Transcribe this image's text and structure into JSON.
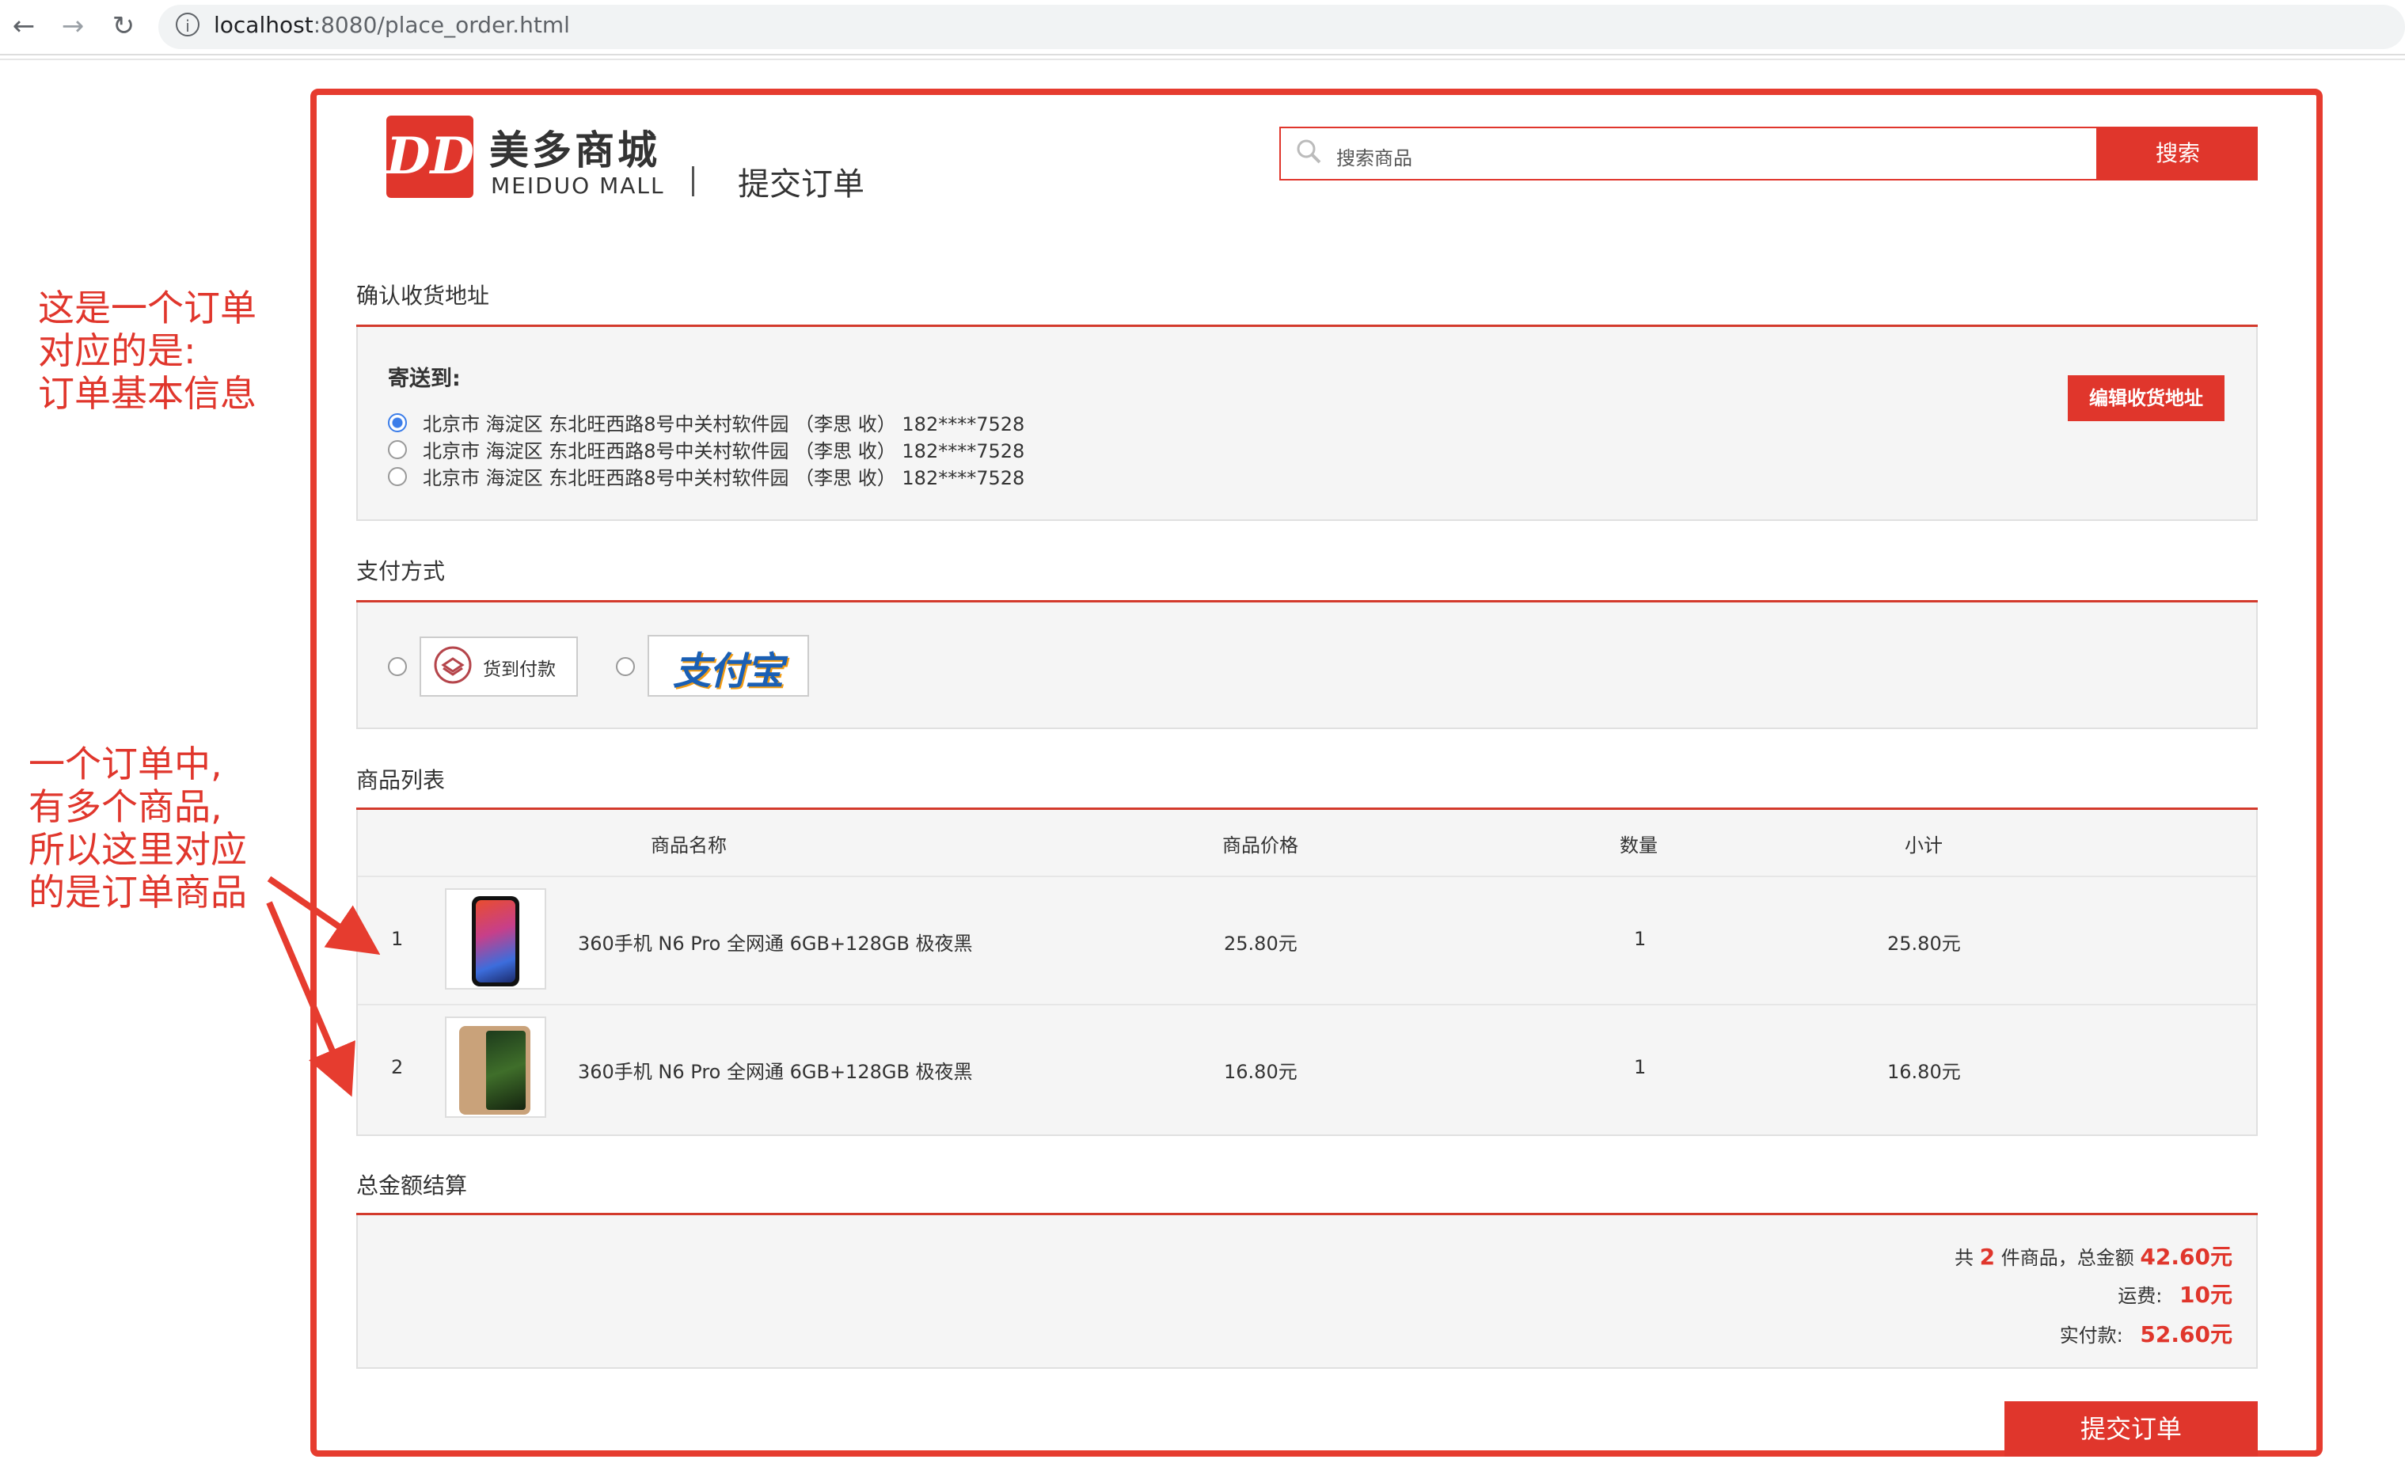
{
  "browser": {
    "back_icon": "arrow-left-icon",
    "forward_icon": "arrow-right-icon",
    "reload_icon": "reload-icon",
    "url_host": "localhost",
    "url_path": ":8080/place_order.html"
  },
  "header": {
    "logo_mark": "DD",
    "logo_cn": "美多商城",
    "logo_en": "MEIDUO MALL",
    "page_title": "提交订单"
  },
  "search": {
    "placeholder": "搜索商品",
    "button": "搜索"
  },
  "address": {
    "section_title": "确认收货地址",
    "label": "寄送到:",
    "edit_button": "编辑收货地址",
    "options": [
      {
        "text": "北京市 海淀区 东北旺西路8号中关村软件园 （李思 收） 182****7528",
        "selected": true
      },
      {
        "text": "北京市 海淀区 东北旺西路8号中关村软件园 （李思 收） 182****7528",
        "selected": false
      },
      {
        "text": "北京市 海淀区 东北旺西路8号中关村软件园 （李思 收） 182****7528",
        "selected": false
      }
    ]
  },
  "payment": {
    "section_title": "支付方式",
    "cod_label": "货到付款",
    "alipay_label": "支付宝"
  },
  "goods": {
    "section_title": "商品列表",
    "columns": [
      "商品名称",
      "商品价格",
      "数量",
      "小计"
    ],
    "rows": [
      {
        "index": "1",
        "name": "360手机 N6 Pro 全网通 6GB+128GB 极夜黑",
        "price": "25.80元",
        "qty": "1",
        "subtotal": "25.80元"
      },
      {
        "index": "2",
        "name": "360手机 N6 Pro 全网通 6GB+128GB 极夜黑",
        "price": "16.80元",
        "qty": "1",
        "subtotal": "16.80元"
      }
    ]
  },
  "totals": {
    "section_title": "总金额结算",
    "count_prefix": "共",
    "count": "2",
    "count_suffix": "件商品，总金额",
    "total": "42.60元",
    "freight_label": "运费:",
    "freight": "10元",
    "pay_label": "实付款:",
    "pay": "52.60元"
  },
  "submit_button": "提交订单",
  "annotations": {
    "note1": [
      "这是一个订单",
      "对应的是:",
      "订单基本信息"
    ],
    "note2": [
      "一个订单中,",
      "有多个商品,",
      "所以这里对应",
      "的是订单商品"
    ]
  },
  "colors": {
    "accent": "#e0362c",
    "annotation": "#e63c2f"
  }
}
